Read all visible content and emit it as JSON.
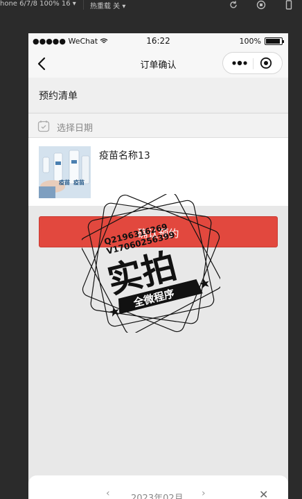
{
  "simulator": {
    "device_label": "hone 6/7/8 100% 16 ▾",
    "hot_reload_label": "热重载 关 ▾"
  },
  "status_bar": {
    "carrier": "●●●●● WeChat",
    "time": "16:22",
    "battery": "100%"
  },
  "nav": {
    "title": "订单确认"
  },
  "section": {
    "title": "预约清单"
  },
  "date_picker": {
    "placeholder": "选择日期"
  },
  "item": {
    "name": "疫苗名称13",
    "image_text_1": "疫苗",
    "image_text_2": "疫苗"
  },
  "confirm_button": {
    "label": "确认预约"
  },
  "watermark": {
    "line1": "Q2196316269",
    "line2": "V17060256399",
    "main": "实拍",
    "banner": "全微程序"
  },
  "calendar_sheet": {
    "prev": "‹",
    "month": "2023年02月",
    "next": "›",
    "close": "✕"
  },
  "colors": {
    "accent": "#e2483e",
    "nav_bg": "#f7f7f7",
    "page_bg": "#e8e8e8"
  }
}
